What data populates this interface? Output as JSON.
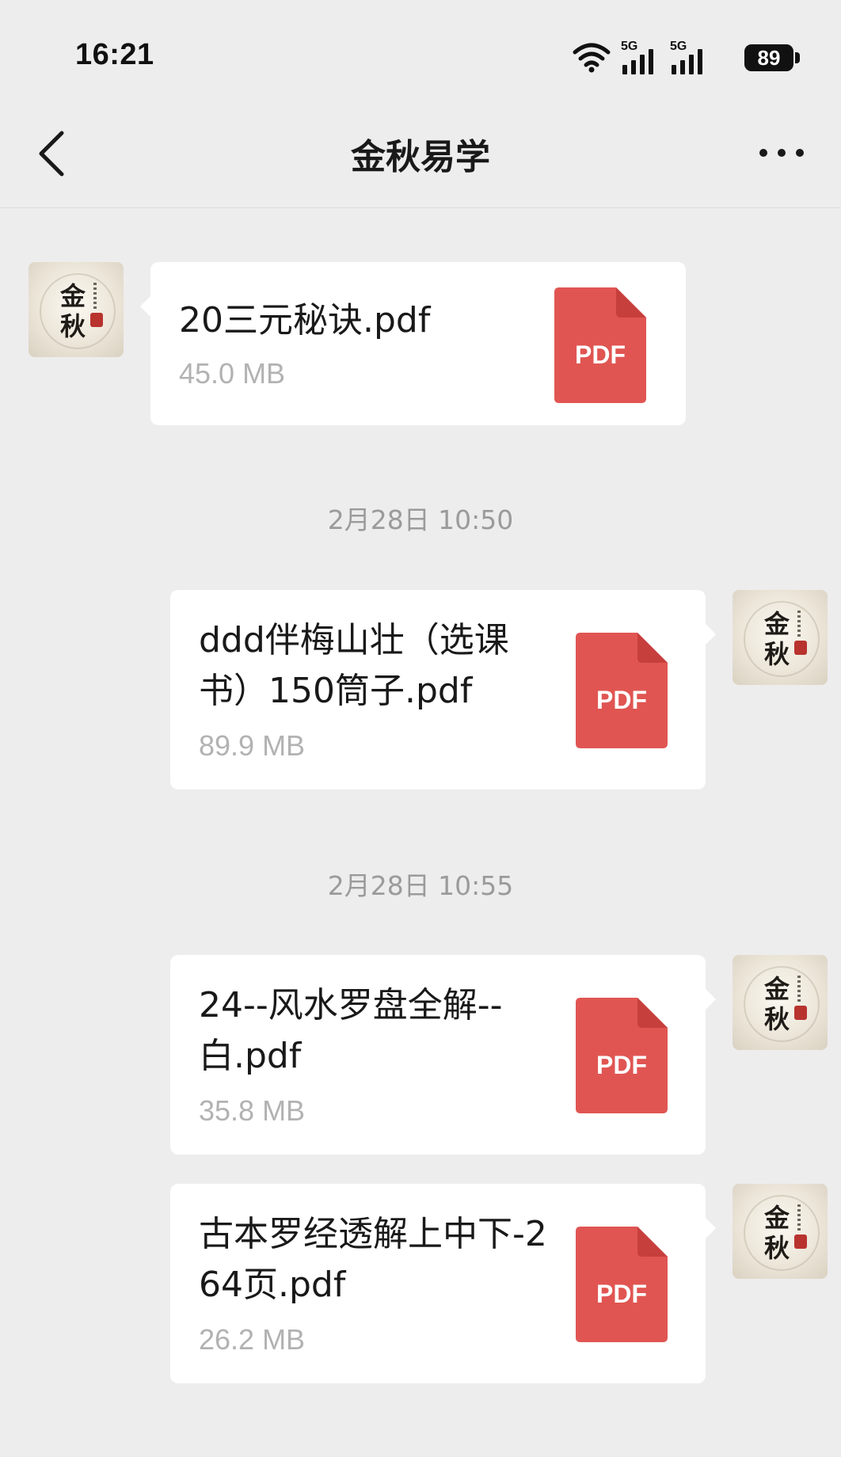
{
  "status_bar": {
    "time": "16:21",
    "battery": "89",
    "network_1": "5G",
    "network_2": "5G"
  },
  "nav": {
    "title": "金秋易学"
  },
  "avatar": {
    "line1": "金",
    "line2": "秋"
  },
  "messages": [
    {
      "file_name": "20三元秘诀.pdf",
      "file_size": "45.0 MB",
      "file_type": "PDF",
      "sender": "other"
    },
    {
      "timestamp": "2月28日 10:50"
    },
    {
      "file_name": "ddd伴梅山壮（选课书）150筒子.pdf",
      "file_size": "89.9 MB",
      "file_type": "PDF",
      "sender": "self"
    },
    {
      "timestamp": "2月28日 10:55"
    },
    {
      "file_name": "24--风水罗盘全解--白.pdf",
      "file_size": "35.8 MB",
      "file_type": "PDF",
      "sender": "self"
    },
    {
      "file_name": "古本罗经透解上中下-264页.pdf",
      "file_size": "26.2 MB",
      "file_type": "PDF",
      "sender": "self"
    }
  ],
  "colors": {
    "background": "#ededed",
    "bubble": "#ffffff",
    "pdf_red": "#e05552",
    "size_gray": "#b2b2b2",
    "timestamp_gray": "#9b9b9b"
  },
  "icons": [
    "wifi-icon",
    "signal-icon",
    "battery-icon",
    "back-chevron-icon",
    "more-dots-icon",
    "pdf-file-icon"
  ]
}
